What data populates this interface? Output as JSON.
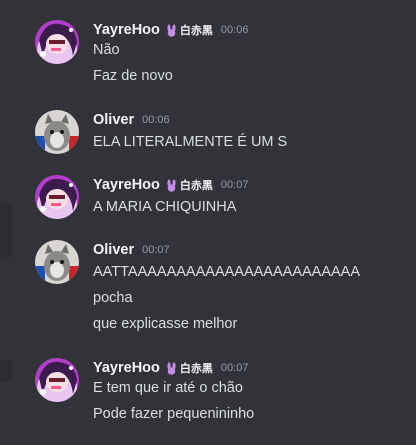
{
  "messages": [
    {
      "username": "YayreHoo",
      "tag": "白赤黑",
      "time": "00:06",
      "lines": [
        "Não",
        "Faz de novo"
      ],
      "avatar": "anime-girl-avatar"
    },
    {
      "username": "Oliver",
      "tag": "",
      "time": "00:06",
      "lines": [
        "ELA LITERALMENTE É UM S"
      ],
      "avatar": "cat-avatar"
    },
    {
      "username": "YayreHoo",
      "tag": "白赤黑",
      "time": "00:07",
      "lines": [
        "A MARIA CHIQUINHA"
      ],
      "avatar": "anime-girl-avatar"
    },
    {
      "username": "Oliver",
      "tag": "",
      "time": "00:07",
      "lines": [
        "AATTAAAAAAAAAAAAAAAAAAAAAAAA",
        "pocha",
        "que explicasse melhor"
      ],
      "avatar": "cat-avatar"
    },
    {
      "username": "YayreHoo",
      "tag": "白赤黑",
      "time": "00:07",
      "lines": [
        "E tem que ir até o chão",
        "Pode fazer pequenininho"
      ],
      "avatar": "anime-girl-avatar"
    }
  ],
  "colors": {
    "background": "#313338",
    "username": "#f2f3f5",
    "text": "#dbdee1",
    "timestamp": "#949ba4",
    "tag_bunny": "#c58be8"
  }
}
